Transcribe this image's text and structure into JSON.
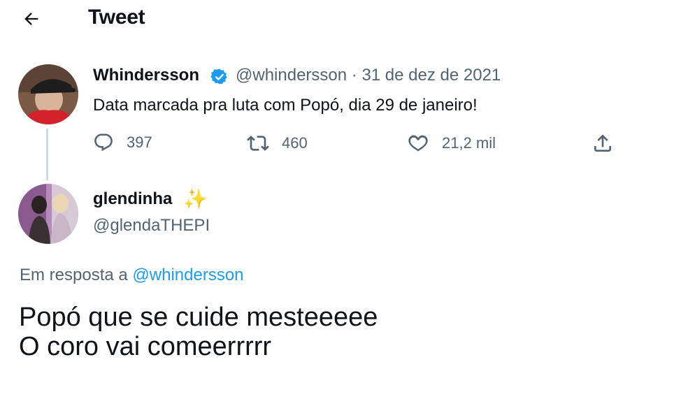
{
  "header": {
    "title": "Tweet"
  },
  "parent_tweet": {
    "display_name": "Whindersson",
    "handle": "@whindersson",
    "date_sep": " · ",
    "date": "31 de dez de 2021",
    "text": "Data marcada pra luta com Popó, dia 29 de janeiro!",
    "replies": "397",
    "retweets": "460",
    "likes": "21,2 mil",
    "colors": {
      "verified": "#1d9bf0"
    }
  },
  "reply_tweet": {
    "display_name": "glendinha",
    "emoji": "✨",
    "handle": "@glendaTHEPI",
    "reply_prefix": "Em resposta a",
    "reply_mention": "@whindersson",
    "text_line1": "Popó que se cuide mesteeeee",
    "text_line2": "O coro vai comeerrrrr"
  }
}
